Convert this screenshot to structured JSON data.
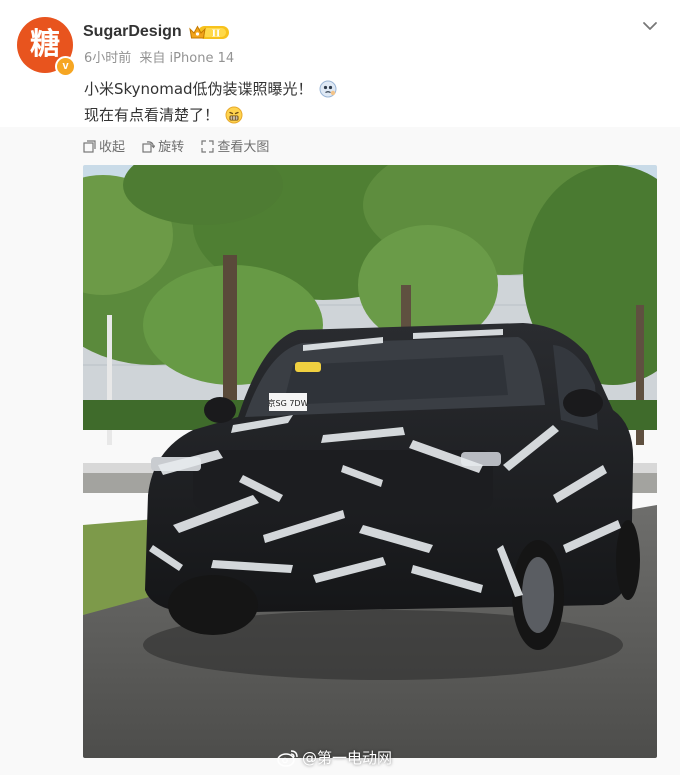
{
  "author": {
    "avatar_text": "糖",
    "verified_mark": "v",
    "name": "SugarDesign",
    "member_level": "II"
  },
  "meta": {
    "time": "6小时前",
    "source": "来自 iPhone 14"
  },
  "post": {
    "line1": "小米Skynomad低伪装谍照曝光！",
    "line2": "现在有点看清楚了！"
  },
  "toolbar": {
    "collect": "收起",
    "rotate": "旋转",
    "view_large": "查看大图"
  },
  "photo": {
    "plate": "京SG 7DW",
    "watermark": "@第一电动网"
  },
  "icons": [
    "menu-chevron-icon",
    "collect-icon",
    "rotate-icon",
    "view-large-icon",
    "weibo-logo-icon",
    "thinking-emoji-icon",
    "grimace-emoji-icon"
  ]
}
